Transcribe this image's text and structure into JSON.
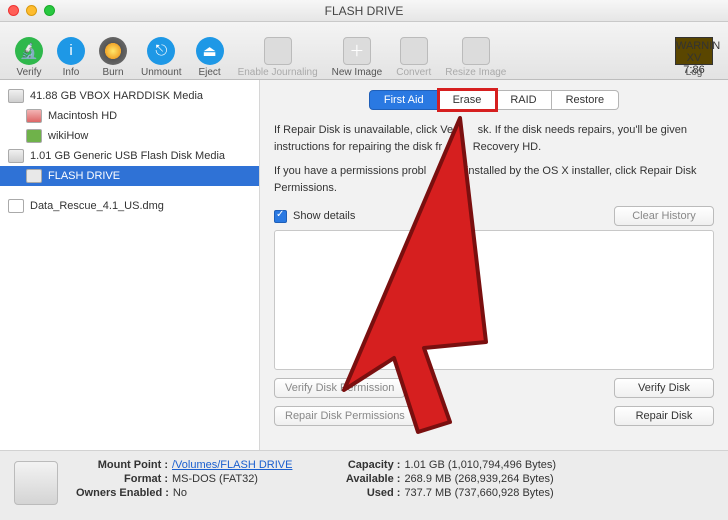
{
  "window": {
    "title": "FLASH DRIVE"
  },
  "toolbar": {
    "verify": "Verify",
    "info": "Info",
    "burn": "Burn",
    "unmount": "Unmount",
    "eject": "Eject",
    "journal": "Enable Journaling",
    "newimg": "New Image",
    "convert": "Convert",
    "resize": "Resize Image",
    "log": "Log",
    "warn1": "WARNIN",
    "warn2": "XV 7:86"
  },
  "sidebar": {
    "items": [
      {
        "label": "41.88 GB VBOX HARDDISK Media"
      },
      {
        "label": "Macintosh HD"
      },
      {
        "label": "wikiHow"
      },
      {
        "label": "1.01 GB Generic USB Flash Disk Media"
      },
      {
        "label": "FLASH DRIVE"
      },
      {
        "label": "Data_Rescue_4.1_US.dmg"
      }
    ]
  },
  "tabs": {
    "firstaid": "First Aid",
    "erase": "Erase",
    "raid": "RAID",
    "restore": "Restore"
  },
  "info": {
    "p1a": "If Repair Disk is unavailable, click Ve",
    "p1b": "sk. If the disk needs repairs, you'll be given instructions for repairing the disk fr",
    "p1c": "Recovery HD.",
    "p2a": "If you have a permissions probl",
    "p2b": "installed by the OS X installer, click Repair Disk Permissions."
  },
  "controls": {
    "showdetails": "Show details",
    "clearhistory": "Clear History",
    "verifyperm": "Verify Disk Permission",
    "repairperm": "Repair Disk Permissions",
    "verifydisk": "Verify Disk",
    "repairdisk": "Repair Disk"
  },
  "footer": {
    "mount_l": "Mount Point :",
    "mount_v": "/Volumes/FLASH DRIVE",
    "format_l": "Format :",
    "format_v": "MS-DOS (FAT32)",
    "owners_l": "Owners Enabled :",
    "owners_v": "No",
    "cap_l": "Capacity :",
    "cap_v": "1.01 GB (1,010,794,496 Bytes)",
    "avail_l": "Available :",
    "avail_v": "268.9 MB (268,939,264 Bytes)",
    "used_l": "Used :",
    "used_v": "737.7 MB (737,660,928 Bytes)"
  }
}
